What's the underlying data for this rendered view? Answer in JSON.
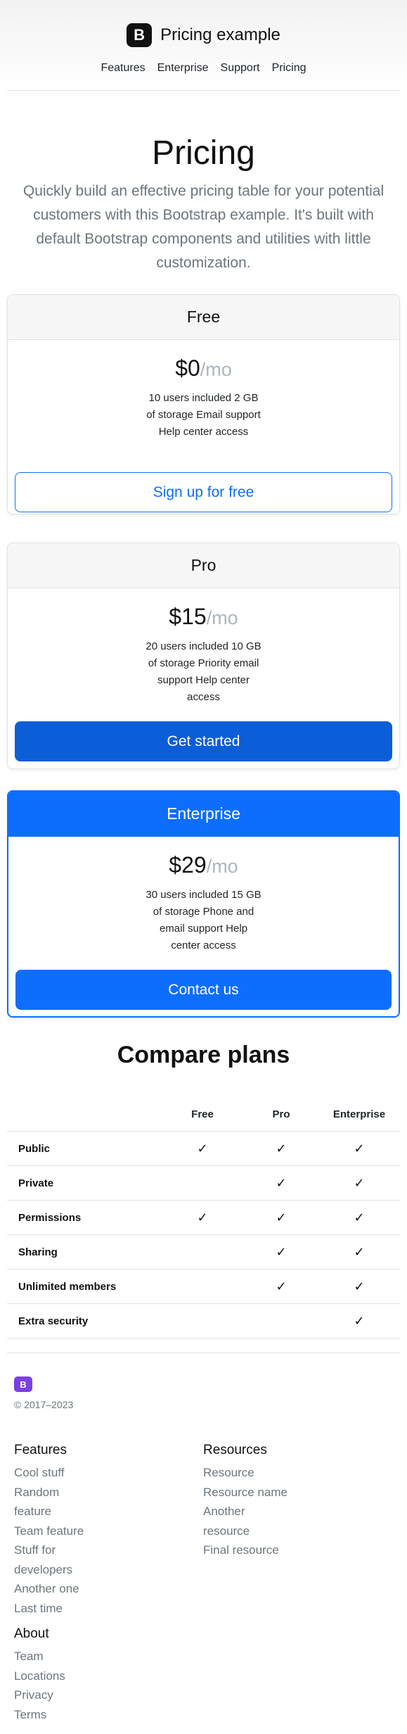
{
  "header": {
    "brand_logo": "B",
    "brand_name": "Pricing example",
    "nav": [
      "Features",
      "Enterprise",
      "Support",
      "Pricing"
    ]
  },
  "intro": {
    "title": "Pricing",
    "lead": "Quickly build an effective pricing table for your potential customers with this Bootstrap example. It's built with default Bootstrap components and utilities with little customization."
  },
  "plans": [
    {
      "name": "Free",
      "price": "$0",
      "per": "/mo",
      "features": "10 users included 2 GB of storage Email support Help center access",
      "button": "Sign up for free"
    },
    {
      "name": "Pro",
      "price": "$15",
      "per": "/mo",
      "features": "20 users included 10 GB of storage Priority email support Help center access",
      "button": "Get started"
    },
    {
      "name": "Enterprise",
      "price": "$29",
      "per": "/mo",
      "features": "30 users included 15 GB of storage Phone and email support Help center access",
      "button": "Contact us"
    }
  ],
  "compare": {
    "title": "Compare plans",
    "columns": [
      "Free",
      "Pro",
      "Enterprise"
    ],
    "check_glyph": "✓",
    "rows": [
      {
        "label": "Public",
        "free": true,
        "pro": true,
        "enterprise": true
      },
      {
        "label": "Private",
        "free": false,
        "pro": true,
        "enterprise": true
      },
      {
        "label": "Permissions",
        "free": true,
        "pro": true,
        "enterprise": true
      },
      {
        "label": "Sharing",
        "free": false,
        "pro": true,
        "enterprise": true
      },
      {
        "label": "Unlimited members",
        "free": false,
        "pro": true,
        "enterprise": true
      },
      {
        "label": "Extra security",
        "free": false,
        "pro": false,
        "enterprise": true
      }
    ]
  },
  "footer": {
    "logo": "B",
    "copyright": "© 2017–2023",
    "features": {
      "heading": "Features",
      "links": [
        "Cool stuff",
        "Random feature",
        "Team feature",
        "Stuff for developers",
        "Another one",
        "Last time"
      ]
    },
    "resources": {
      "heading": "Resources",
      "links": [
        "Resource",
        "Resource name",
        "Another resource",
        "Final resource"
      ]
    },
    "about": {
      "heading": "About",
      "links": [
        "Team",
        "Locations",
        "Privacy",
        "Terms"
      ]
    }
  },
  "colors": {
    "primary": "#0d6efd",
    "footer_logo": "#7b3fe4"
  }
}
